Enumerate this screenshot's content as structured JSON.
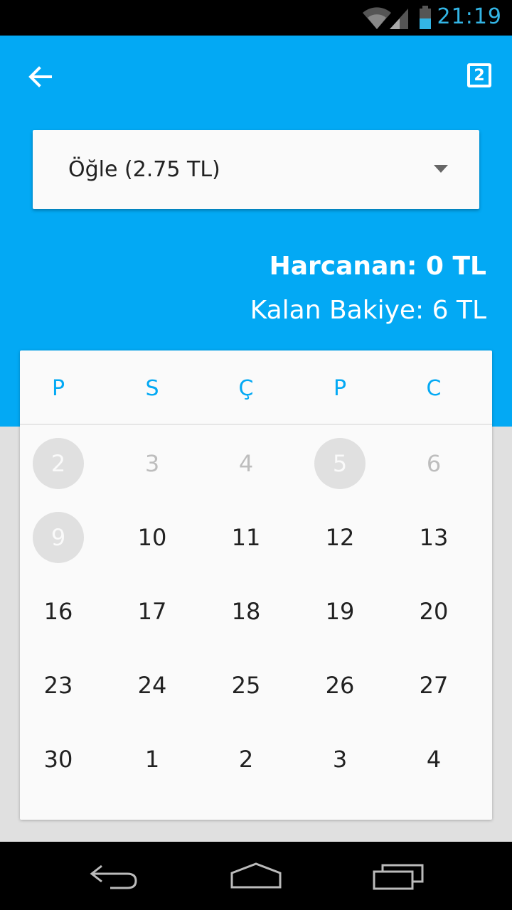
{
  "status_bar": {
    "time": "21:19"
  },
  "header": {
    "badge_text": "2"
  },
  "meal_select": {
    "selected": "Öğle (2.75 TL)"
  },
  "summary": {
    "spent": "Harcanan: 0 TL",
    "balance": "Kalan Bakiye: 6 TL"
  },
  "calendar": {
    "weekdays": [
      "P",
      "S",
      "Ç",
      "P",
      "C"
    ],
    "weeks": [
      [
        "2",
        "3",
        "4",
        "5",
        "6"
      ],
      [
        "9",
        "10",
        "11",
        "12",
        "13"
      ],
      [
        "16",
        "17",
        "18",
        "19",
        "20"
      ],
      [
        "23",
        "24",
        "25",
        "26",
        "27"
      ],
      [
        "30",
        "1",
        "2",
        "3",
        "4"
      ]
    ],
    "circled_days": [
      "2",
      "5",
      "9"
    ],
    "muted_days": [
      "2",
      "3",
      "4",
      "5",
      "6",
      "9"
    ]
  },
  "colors": {
    "primary": "#03a9f4",
    "status_accent": "#33b5e5",
    "background": "#e0e0e0",
    "card": "#fafafa"
  },
  "icons": {
    "back": "arrow-back-icon",
    "badge": "counter-badge-icon",
    "dropdown": "caret-down-icon",
    "wifi": "wifi-icon",
    "signal": "signal-icon",
    "battery": "battery-icon",
    "nav_back": "nav-back-icon",
    "nav_home": "nav-home-icon",
    "nav_recents": "nav-recents-icon"
  }
}
